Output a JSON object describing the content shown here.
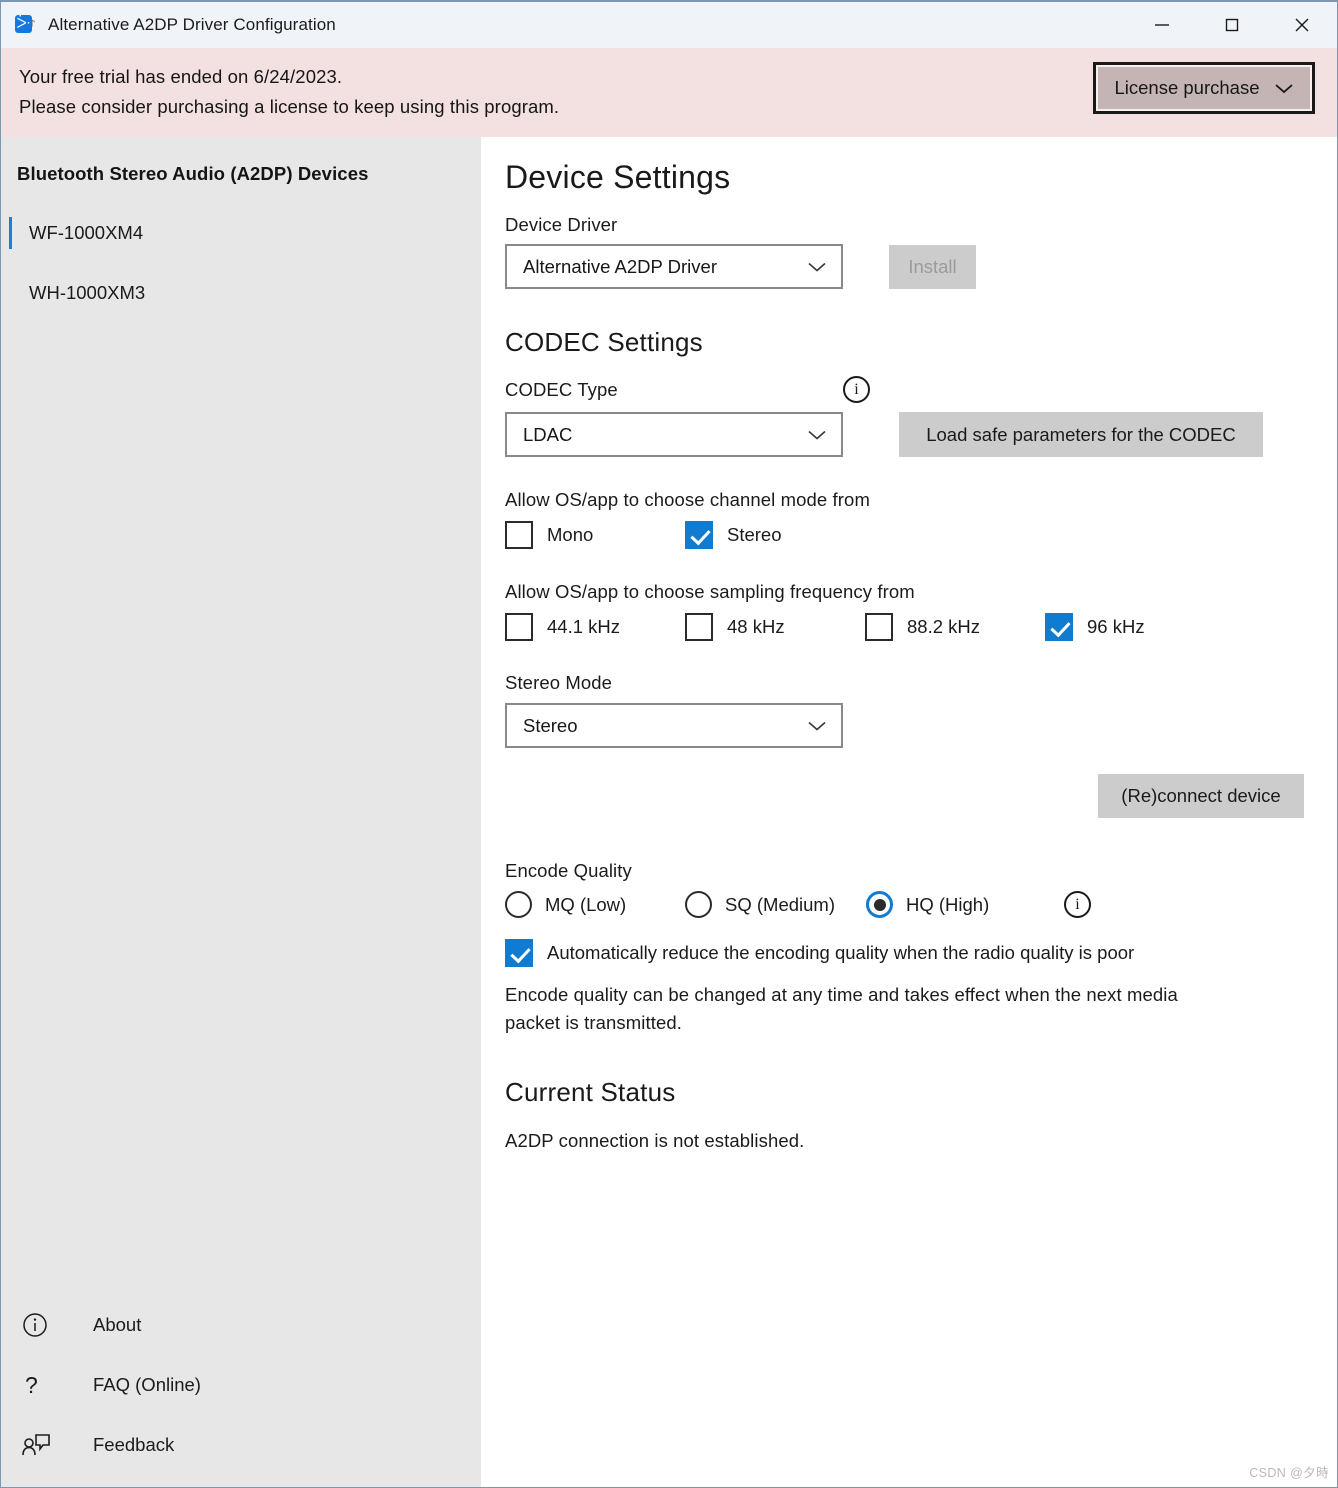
{
  "window": {
    "title": "Alternative A2DP Driver Configuration",
    "icon": "bluetooth-audio-icon",
    "controls": {
      "minimize": "minimize-icon",
      "maximize": "maximize-icon",
      "close": "close-icon"
    }
  },
  "banner": {
    "line1": "Your free trial has ended on 6/24/2023.",
    "line2": "Please consider purchasing a license to keep using this program.",
    "button_label": "License purchase",
    "button_icon": "chevron-down-icon",
    "background": "#f3e0e0"
  },
  "sidebar": {
    "heading": "Bluetooth Stereo Audio (A2DP) Devices",
    "devices": [
      {
        "label": "WF-1000XM4",
        "selected": true
      },
      {
        "label": "WH-1000XM3",
        "selected": false
      }
    ],
    "accent_color": "#1b7fd4",
    "links": [
      {
        "label": "About",
        "icon": "info-circle-icon"
      },
      {
        "label": "FAQ (Online)",
        "icon": "question-mark-icon"
      },
      {
        "label": "Feedback",
        "icon": "feedback-person-icon"
      }
    ]
  },
  "main": {
    "device_settings": {
      "heading": "Device Settings",
      "driver_label": "Device Driver",
      "driver_value": "Alternative A2DP Driver",
      "install_label": "Install",
      "install_disabled": true
    },
    "codec_settings": {
      "heading": "CODEC Settings",
      "codec_type_label": "CODEC Type",
      "codec_type_value": "LDAC",
      "codec_info_icon": "info-circle-icon",
      "load_safe_label": "Load safe parameters for the CODEC",
      "channel_mode_label": "Allow OS/app to choose channel mode from",
      "channel_modes": [
        {
          "label": "Mono",
          "checked": false
        },
        {
          "label": "Stereo",
          "checked": true
        }
      ],
      "sampling_label": "Allow OS/app to choose sampling frequency from",
      "sampling_rates": [
        {
          "label": "44.1 kHz",
          "checked": false
        },
        {
          "label": "48 kHz",
          "checked": false
        },
        {
          "label": "88.2 kHz",
          "checked": false
        },
        {
          "label": "96 kHz",
          "checked": true
        }
      ],
      "stereo_mode_label": "Stereo Mode",
      "stereo_mode_value": "Stereo",
      "reconnect_label": "(Re)connect device"
    },
    "encode_quality": {
      "label": "Encode Quality",
      "options": [
        {
          "label": "MQ (Low)",
          "selected": false
        },
        {
          "label": "SQ (Medium)",
          "selected": false
        },
        {
          "label": "HQ (High)",
          "selected": true
        }
      ],
      "info_icon": "info-circle-icon",
      "auto_reduce_label": "Automatically reduce the encoding quality when the radio quality is poor",
      "auto_reduce_checked": true,
      "note_line1": "Encode quality can be changed at any time and takes effect when the next media",
      "note_line2": "packet is transmitted."
    },
    "current_status": {
      "heading": "Current Status",
      "text": "A2DP connection is not established."
    }
  },
  "watermark": "CSDN @夕時"
}
